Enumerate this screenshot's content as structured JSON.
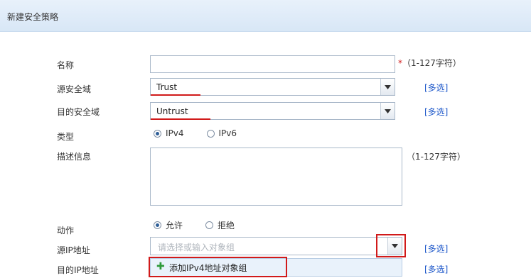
{
  "header": {
    "title": "新建安全策略"
  },
  "form": {
    "name": {
      "label": "名称",
      "value": "",
      "required_mark": "*",
      "hint": "（1-127字符）"
    },
    "src_zone": {
      "label": "源安全域",
      "value": "Trust",
      "multi_link": "[多选]"
    },
    "dst_zone": {
      "label": "目的安全域",
      "value": "Untrust",
      "multi_link": "[多选]"
    },
    "type": {
      "label": "类型",
      "options": [
        "IPv4",
        "IPv6"
      ],
      "selected": "IPv4"
    },
    "description": {
      "label": "描述信息",
      "value": "",
      "hint": "（1-127字符）"
    },
    "action": {
      "label": "动作",
      "options": [
        "允许",
        "拒绝"
      ],
      "selected": "允许"
    },
    "src_ip": {
      "label": "源IP地址",
      "placeholder": "请选择或输入对象组",
      "multi_link": "[多选]"
    },
    "dst_ip": {
      "label": "目的IP地址",
      "multi_link": "[多选]"
    },
    "dropdown_option": {
      "icon": "plus-icon",
      "label": "添加IPv4地址对象组"
    }
  },
  "colors": {
    "accent_red": "#d11a1a",
    "link_blue": "#1a55c9",
    "header_bg": "#dde9f7"
  }
}
